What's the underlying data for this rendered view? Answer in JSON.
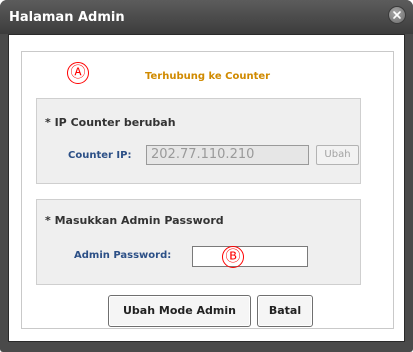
{
  "window": {
    "title": "Halaman Admin"
  },
  "markers": {
    "a": "Ⓐ",
    "b": "Ⓑ"
  },
  "status": {
    "connection_text": "Terhubung ke Counter"
  },
  "ip_section": {
    "title": "* IP Counter berubah",
    "label": "Counter IP:",
    "value": "202.77.110.210",
    "button_label": "Ubah"
  },
  "password_section": {
    "title": "* Masukkan Admin Password",
    "label": "Admin Password:",
    "value": ""
  },
  "footer": {
    "change_mode_label": "Ubah Mode Admin",
    "cancel_label": "Batal"
  },
  "colors": {
    "status": "#d08a00",
    "label": "#2b4f86",
    "marker": "#ff0000",
    "titlebar": "#4a4a4a"
  },
  "icons": {
    "close": "close-icon"
  }
}
